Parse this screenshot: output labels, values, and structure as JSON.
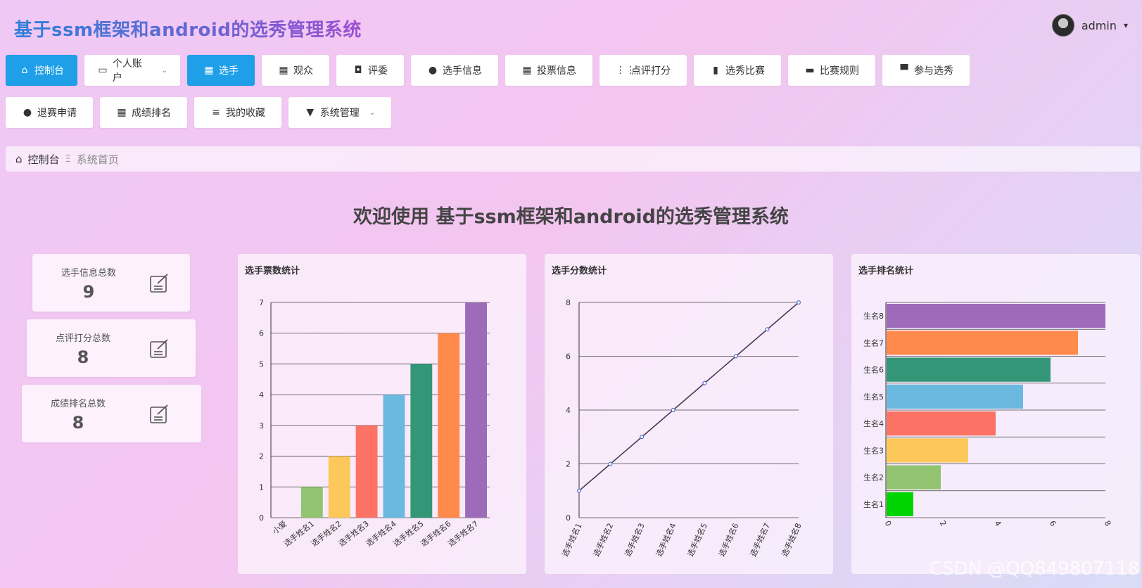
{
  "app": {
    "title": "基于ssm框架和android的选秀管理系统"
  },
  "user": {
    "name": "admin",
    "caret": "▾"
  },
  "nav": [
    {
      "label": "控制台",
      "icon": "home-icon",
      "glyph": "⌂",
      "active": true
    },
    {
      "label": "个人账户",
      "icon": "wallet-icon",
      "glyph": "▭",
      "dropdown": true
    },
    {
      "label": "选手",
      "icon": "grid-icon",
      "glyph": "▦",
      "active": true
    },
    {
      "label": "观众",
      "icon": "grid-icon",
      "glyph": "▦"
    },
    {
      "label": "评委",
      "icon": "wallet-icon",
      "glyph": "◘"
    },
    {
      "label": "选手信息",
      "icon": "user-icon",
      "glyph": "●"
    },
    {
      "label": "投票信息",
      "icon": "grid-icon",
      "glyph": "▦"
    },
    {
      "label": "点评打分",
      "icon": "apps-icon",
      "glyph": "⋮⋮"
    },
    {
      "label": "选秀比赛",
      "icon": "bar-chart-icon",
      "glyph": "▮"
    },
    {
      "label": "比赛规则",
      "icon": "briefcase-icon",
      "glyph": "▬"
    },
    {
      "label": "参与选秀",
      "icon": "inbox-icon",
      "glyph": "▀"
    },
    {
      "label": "退赛申请",
      "icon": "bulb-icon",
      "glyph": "●"
    },
    {
      "label": "成绩排名",
      "icon": "grid-icon",
      "glyph": "▦"
    },
    {
      "label": "我的收藏",
      "icon": "sliders-icon",
      "glyph": "≡"
    },
    {
      "label": "系统管理",
      "icon": "brush-icon",
      "glyph": "▼",
      "dropdown": true
    }
  ],
  "breadcrumb": {
    "home": "控制台",
    "separator": "Ξ",
    "current": "系统首页"
  },
  "welcome": "欢迎使用 基于ssm框架和android的选秀管理系统",
  "stats": [
    {
      "label": "选手信息总数",
      "value": "9"
    },
    {
      "label": "点评打分总数",
      "value": "8"
    },
    {
      "label": "成绩排名总数",
      "value": "8"
    }
  ],
  "watermark": "CSDN @QQ849807118",
  "chart_data": [
    {
      "type": "bar",
      "title": "选手票数统计",
      "categories": [
        "小爱",
        "选手姓名1",
        "选手姓名2",
        "选手姓名3",
        "选手姓名4",
        "选手姓名5",
        "选手姓名6",
        "选手姓名7"
      ],
      "values": [
        0,
        1,
        2,
        3,
        4,
        5,
        6,
        7
      ],
      "colors": [
        "#5470c6",
        "#91c370",
        "#fdc85a",
        "#fc7366",
        "#6cb9e0",
        "#329677",
        "#ff8a4c",
        "#9d6bb9"
      ],
      "ylim": [
        0,
        7
      ],
      "yticks": [
        0,
        1,
        2,
        3,
        4,
        5,
        6,
        7
      ],
      "grid": true
    },
    {
      "type": "line",
      "title": "选手分数统计",
      "categories": [
        "选手姓名1",
        "选手姓名2",
        "选手姓名3",
        "选手姓名4",
        "选手姓名5",
        "选手姓名6",
        "选手姓名7",
        "选手姓名8"
      ],
      "values": [
        1,
        2,
        3,
        4,
        5,
        6,
        7,
        8
      ],
      "ylim": [
        0,
        8
      ],
      "yticks": [
        0,
        2,
        4,
        6,
        8
      ],
      "line_color": "#4a3a56",
      "point_color": "#5470c6",
      "grid": true
    },
    {
      "type": "bar",
      "orientation": "horizontal",
      "title": "选手排名统计",
      "categories": [
        "生名1",
        "生名2",
        "生名3",
        "生名4",
        "生名5",
        "生名6",
        "生名7",
        "生名8"
      ],
      "values": [
        1,
        2,
        3,
        4,
        5,
        6,
        7,
        8
      ],
      "colors": [
        "#00d400",
        "#91c370",
        "#fdc85a",
        "#fc7366",
        "#6cb9e0",
        "#329677",
        "#ff8a4c",
        "#9d6bb9"
      ],
      "xlim": [
        0,
        8
      ],
      "xticks": [
        0,
        2,
        4,
        6,
        8
      ],
      "grid": true
    }
  ]
}
